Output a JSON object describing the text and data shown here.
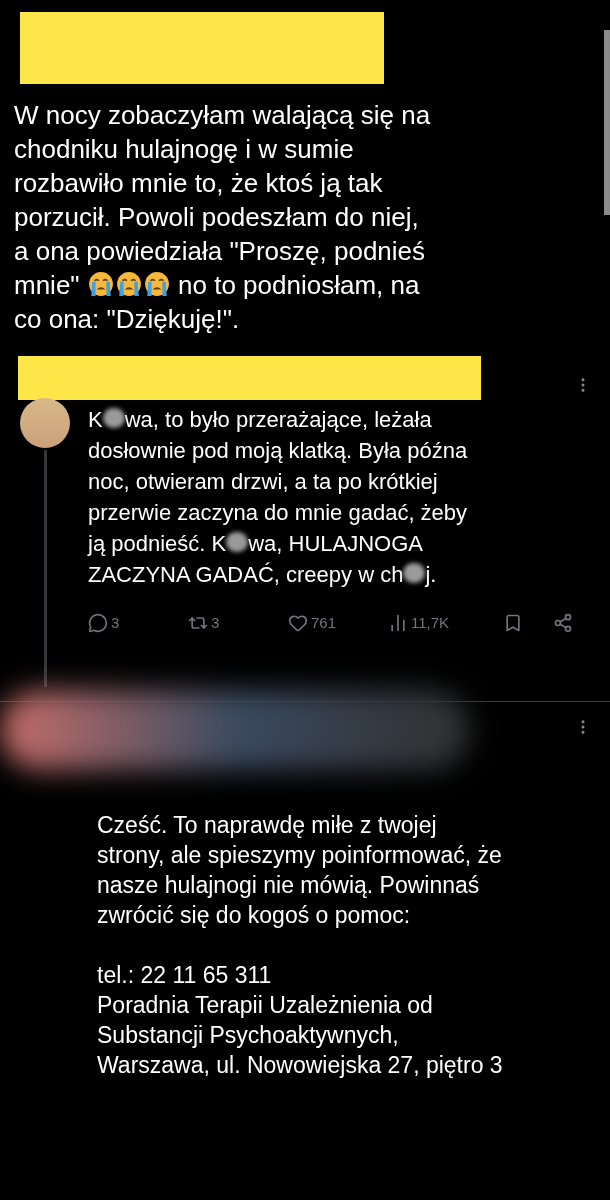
{
  "post": {
    "lines": [
      [
        {
          "kind": "text",
          "text": "W nocy zobaczyłam walającą się na"
        }
      ],
      [
        {
          "kind": "text",
          "text": "chodniku hulajnogę i w sumie"
        }
      ],
      [
        {
          "kind": "text",
          "text": "rozbawiło mnie to, że ktoś ją tak"
        }
      ],
      [
        {
          "kind": "text",
          "text": "porzucił. Powoli podeszłam do niej,"
        }
      ],
      [
        {
          "kind": "text",
          "text": "a ona powiedziała \"Proszę, podnieś"
        }
      ],
      [
        {
          "kind": "text",
          "text": "mnie\" "
        },
        {
          "kind": "emoji"
        },
        {
          "kind": "emoji"
        },
        {
          "kind": "emoji"
        },
        {
          "kind": "text",
          "text": " no to podniosłam, na"
        }
      ],
      [
        {
          "kind": "text",
          "text": "co ona: \"Dziękuję!\"."
        }
      ]
    ]
  },
  "reply": {
    "lines": [
      [
        {
          "kind": "text",
          "text": "K"
        },
        {
          "kind": "blur"
        },
        {
          "kind": "text",
          "text": "wa, to było przerażające, leżała"
        }
      ],
      [
        {
          "kind": "text",
          "text": "dosłownie pod moją klatką. Była późna"
        }
      ],
      [
        {
          "kind": "text",
          "text": "noc, otwieram drzwi, a ta po krótkiej"
        }
      ],
      [
        {
          "kind": "text",
          "text": "przerwie zaczyna do mnie gadać, żeby"
        }
      ],
      [
        {
          "kind": "text",
          "text": "ją podnieść. K"
        },
        {
          "kind": "blur"
        },
        {
          "kind": "text",
          "text": "wa, HULAJNOGA"
        }
      ],
      [
        {
          "kind": "text",
          "text": "ZACZYNA GADAĆ, creepy w ch"
        },
        {
          "kind": "blur"
        },
        {
          "kind": "text",
          "text": "j."
        }
      ]
    ],
    "actions": [
      {
        "kind": "reply",
        "count": "3"
      },
      {
        "kind": "repost",
        "count": "3"
      },
      {
        "kind": "like",
        "count": "761"
      },
      {
        "kind": "views",
        "count": "11,7K"
      },
      {
        "kind": "bookmark"
      },
      {
        "kind": "share"
      }
    ]
  },
  "answer": {
    "paragraphs": [
      [
        [
          {
            "kind": "text",
            "text": "Cześć. To naprawdę miłe z twojej"
          }
        ],
        [
          {
            "kind": "text",
            "text": "strony, ale spieszymy poinformować, że"
          }
        ],
        [
          {
            "kind": "text",
            "text": "nasze hulajnogi nie mówią. Powinnaś"
          }
        ],
        [
          {
            "kind": "text",
            "text": "zwrócić się do kogoś o pomoc:"
          }
        ]
      ],
      [
        [
          {
            "kind": "text",
            "text": "tel.: 22 11 65 311"
          }
        ],
        [
          {
            "kind": "text",
            "text": "Poradnia Terapii Uzależnienia od"
          }
        ],
        [
          {
            "kind": "text",
            "text": "Substancji Psychoaktywnych,"
          }
        ],
        [
          {
            "kind": "text",
            "text": "Warszawa, ul. Nowowiejska 27, piętro 3"
          }
        ]
      ]
    ]
  }
}
